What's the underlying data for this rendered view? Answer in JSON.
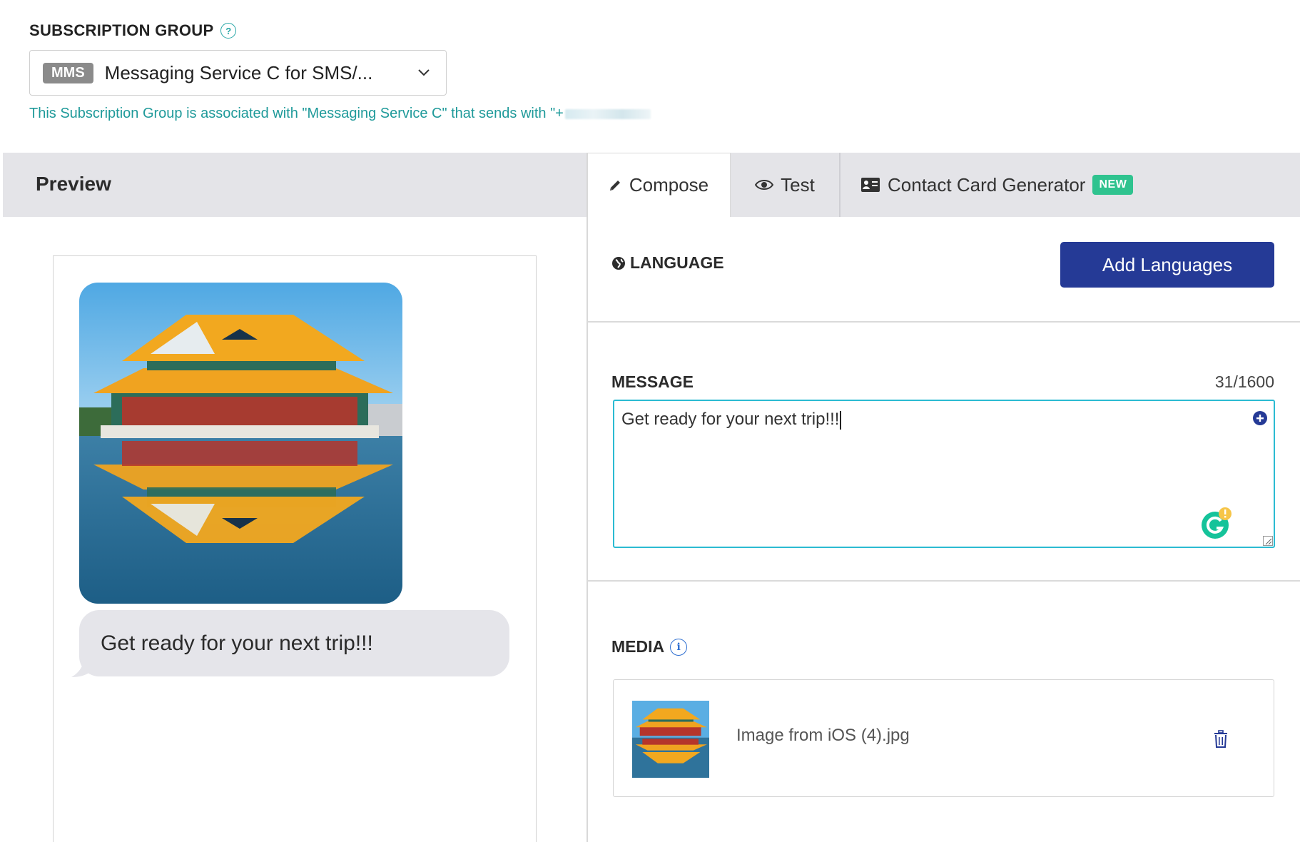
{
  "subscription": {
    "label": "SUBSCRIPTION GROUP",
    "help_glyph": "?",
    "badge": "MMS",
    "selected": "Messaging Service C for SMS/...",
    "note": "This Subscription Group is associated with \"Messaging Service C\" that sends with \"+"
  },
  "preview": {
    "title": "Preview",
    "bubble_text": "Get ready for your next trip!!!",
    "bubble_color": "#e5e5ea"
  },
  "tabs": {
    "compose": "Compose",
    "test": "Test",
    "contact": "Contact Card Generator",
    "new_badge": "NEW"
  },
  "language": {
    "label": "LANGUAGE",
    "add_button": "Add Languages",
    "button_color": "#253a96"
  },
  "message": {
    "label": "MESSAGE",
    "count": "31/1600",
    "value": "Get ready for your next trip!!!",
    "border_color": "#2bbbd2"
  },
  "media": {
    "label": "MEDIA",
    "info_glyph": "i",
    "filename": "Image from iOS (4).jpg"
  },
  "colors": {
    "accent_teal": "#1f9a9a",
    "new_badge": "#2fc38f",
    "band_gray": "#e4e4e8"
  },
  "icons": [
    "help-icon",
    "chevron-down-icon",
    "pencil-icon",
    "eye-icon",
    "contact-card-icon",
    "globe-icon",
    "plus-circle-icon",
    "grammarly-icon",
    "info-icon",
    "trash-icon"
  ]
}
